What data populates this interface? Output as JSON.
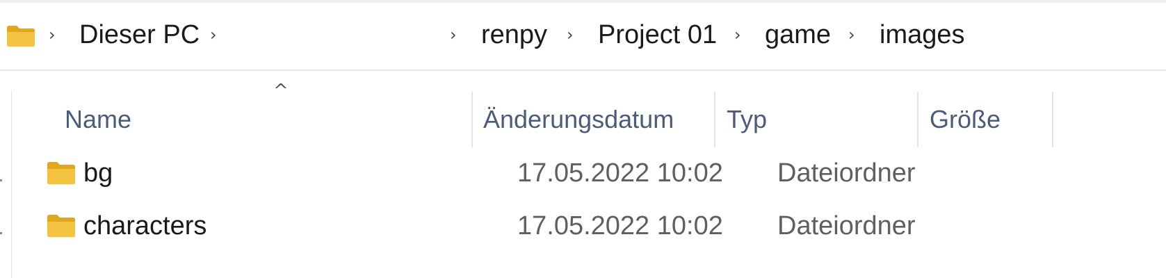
{
  "breadcrumb": {
    "root_icon": "folder-icon",
    "items": [
      "Dieser PC",
      "",
      "renpy",
      "Project 01",
      "game",
      "images"
    ],
    "separator": "›"
  },
  "columns": {
    "sort_indicator": "^",
    "headers": [
      "Name",
      "Änderungsdatum",
      "Typ",
      "Größe"
    ]
  },
  "files": [
    {
      "icon": "folder-icon",
      "name": "bg",
      "modified": "17.05.2022 10:02",
      "type": "Dateiordner",
      "size": ""
    },
    {
      "icon": "folder-icon",
      "name": "characters",
      "modified": "17.05.2022 10:02",
      "type": "Dateiordner",
      "size": ""
    }
  ],
  "colors": {
    "folder": "#f5c342",
    "folder_dark": "#e2a81d",
    "header_text": "#4a5c7a"
  }
}
